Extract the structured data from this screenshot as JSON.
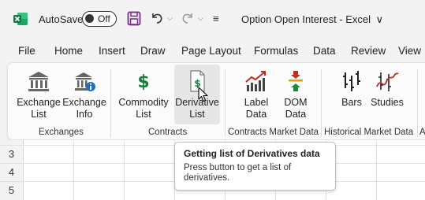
{
  "titlebar": {
    "autosave_label": "AutoSave",
    "toggle_state": "Off",
    "document_title": "Option Open Interest  -  Excel",
    "title_chevron": "∨",
    "qat_more": "≡"
  },
  "menu": [
    "File",
    "Home",
    "Insert",
    "Draw",
    "Page Layout",
    "Formulas",
    "Data",
    "Review",
    "View"
  ],
  "ribbon": {
    "buttons": [
      {
        "line1": "Exchange",
        "line2": "List",
        "icon": "bank-icon"
      },
      {
        "line1": "Exchange",
        "line2": "Info",
        "icon": "bank-info-icon"
      },
      {
        "line1": "Commodity",
        "line2": "List",
        "icon": "dollar-icon"
      },
      {
        "line1": "Derivative",
        "line2": "List",
        "icon": "dollar-document-icon"
      },
      {
        "line1": "Label",
        "line2": "Data",
        "icon": "label-chart-icon"
      },
      {
        "line1": "DOM",
        "line2": "Data",
        "icon": "dom-icon"
      },
      {
        "line1": "Bars",
        "line2": "",
        "icon": "bars-icon"
      },
      {
        "line1": "Studies",
        "line2": "",
        "icon": "studies-icon"
      }
    ],
    "groups": [
      "Exchanges",
      "Contracts",
      "Contracts Market Data",
      "Historical Market Data",
      "A"
    ]
  },
  "grid": {
    "rows": [
      "3",
      "4",
      "5"
    ]
  },
  "tooltip": {
    "title": "Getting list of Derivatives data",
    "body": "Press button to get a list of derivatives."
  },
  "colors": {
    "excel_green": "#107c41",
    "save_purple": "#7a2a8c",
    "accent_red": "#c42b1c",
    "dollar_green": "#1a7d3c"
  }
}
